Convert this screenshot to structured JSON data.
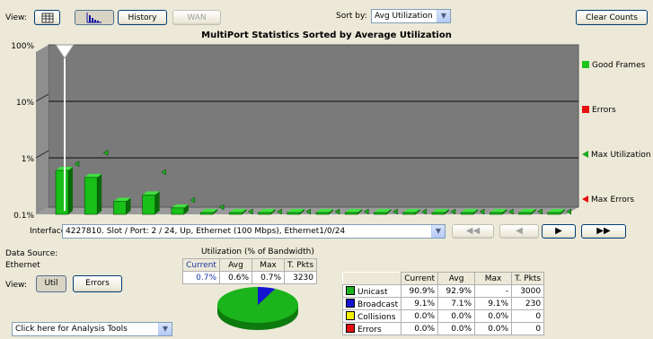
{
  "toolbar": {
    "view_label": "View:",
    "history_label": "History",
    "wan_label": "WAN",
    "sort_label": "Sort by:",
    "sort_value": "Avg Utilization",
    "clear_counts_label": "Clear Counts"
  },
  "chart": {
    "title": "MultiPort Statistics Sorted by Average Utilization",
    "y_ticks": [
      "100%",
      "10%",
      "1%",
      "0.1%"
    ],
    "legend": [
      {
        "label": "Good Frames",
        "marker": "square",
        "color": "#1cc41c"
      },
      {
        "label": "Errors",
        "marker": "square",
        "color": "#e81010"
      },
      {
        "label": "Max Utilization",
        "marker": "triangle",
        "color": "#1ca81c"
      },
      {
        "label": "Max Errors",
        "marker": "triangle",
        "color": "#e81010"
      }
    ],
    "colors": {
      "plot_back": "#7a7a7a",
      "plot_floor": "#9a9a9a",
      "bar": "#18c018",
      "bar_top": "#40e040",
      "bar_side": "#0a6a0a"
    }
  },
  "chart_data": {
    "type": "bar",
    "title": "MultiPort Statistics Sorted by Average Utilization",
    "y_scale": "log",
    "ylim": [
      0.1,
      100
    ],
    "series": [
      {
        "name": "Good Frames",
        "values": [
          0.6,
          0.45,
          0.17,
          0.22,
          0.13,
          0.1,
          0.1,
          0.1,
          0.1,
          0.1,
          0.1,
          0.1,
          0.1,
          0.1,
          0.1,
          0.1,
          0.1,
          0.1
        ]
      },
      {
        "name": "Max Utilization",
        "values": [
          0.7,
          1.1,
          null,
          0.5,
          0.16,
          0.12,
          0.1,
          0.1,
          0.1,
          0.1,
          0.1,
          0.1,
          0.1,
          0.1,
          0.1,
          0.1,
          0.1,
          0.1
        ]
      }
    ]
  },
  "interface": {
    "label": "Interface:",
    "value": "4227810. Slot / Port: 2 / 24, Up, Ethernet (100 Mbps), Ethernet1/0/24"
  },
  "data_source": {
    "label": "Data Source:",
    "value": "Ethernet"
  },
  "view2": {
    "label": "View:",
    "util_label": "Util",
    "errors_label": "Errors"
  },
  "analysis_tools": {
    "value": "Click here for Analysis Tools"
  },
  "utilization": {
    "title": "Utilization (% of Bandwidth)",
    "headers": [
      "Current",
      "Avg",
      "Max",
      "T. Pkts"
    ],
    "values": [
      "0.7%",
      "0.6%",
      "0.7%",
      "3230"
    ]
  },
  "pie": {
    "slices": [
      {
        "name": "Unicast",
        "value": 92.9,
        "color": "#1cb41c"
      },
      {
        "name": "Broadcast",
        "value": 7.1,
        "color": "#1414d0"
      }
    ]
  },
  "frames_table": {
    "headers": [
      "Current",
      "Avg",
      "Max",
      "T. Pkts"
    ],
    "rows": [
      {
        "label": "Unicast",
        "color": "#1cb41c",
        "cells": [
          "90.9%",
          "92.9%",
          "-",
          "3000"
        ]
      },
      {
        "label": "Broadcast",
        "color": "#1414d0",
        "cells": [
          "9.1%",
          "7.1%",
          "9.1%",
          "230"
        ]
      },
      {
        "label": "Collisions",
        "color": "#f0f000",
        "cells": [
          "0.0%",
          "0.0%",
          "0.0%",
          "0"
        ]
      },
      {
        "label": "Errors",
        "color": "#e81010",
        "cells": [
          "0.0%",
          "0.0%",
          "0.0%",
          "0"
        ]
      }
    ]
  }
}
